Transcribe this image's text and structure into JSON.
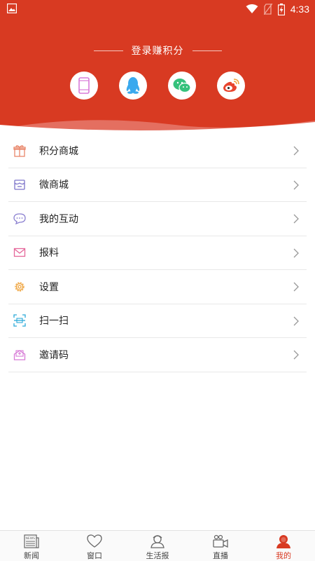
{
  "status_bar": {
    "time": "4:33"
  },
  "header": {
    "login_title": "登录赚积分"
  },
  "login_methods": [
    {
      "name": "phone",
      "icon": "phone-icon",
      "color": "#d97bd8"
    },
    {
      "name": "qq",
      "icon": "qq-icon",
      "color": "#3aa9ee"
    },
    {
      "name": "wechat",
      "icon": "wechat-icon",
      "color": "#35c27c"
    },
    {
      "name": "weibo",
      "icon": "weibo-icon",
      "color": "#e8452e"
    }
  ],
  "menu": [
    {
      "label": "积分商城",
      "icon": "gift-icon",
      "color": "#e9876b"
    },
    {
      "label": "微商城",
      "icon": "shop-icon",
      "color": "#7c74c9"
    },
    {
      "label": "我的互动",
      "icon": "chat-icon",
      "color": "#8a7fd0"
    },
    {
      "label": "报料",
      "icon": "mail-icon",
      "color": "#e5679a"
    },
    {
      "label": "设置",
      "icon": "gear-icon",
      "color": "#efa33c"
    },
    {
      "label": "扫一扫",
      "icon": "scan-icon",
      "color": "#2aa9d8"
    },
    {
      "label": "邀请码",
      "icon": "invite-icon",
      "color": "#d77ad6"
    }
  ],
  "bottom_nav": [
    {
      "label": "新闻",
      "icon": "news-icon",
      "active": false
    },
    {
      "label": "窗口",
      "icon": "heart-icon",
      "active": false
    },
    {
      "label": "生活报",
      "icon": "user-hat-icon",
      "active": false
    },
    {
      "label": "直播",
      "icon": "video-icon",
      "active": false
    },
    {
      "label": "我的",
      "icon": "profile-icon",
      "active": true
    }
  ],
  "colors": {
    "brand_red": "#d83a22",
    "divider": "#e8e8e8",
    "nav_text": "#444444"
  }
}
